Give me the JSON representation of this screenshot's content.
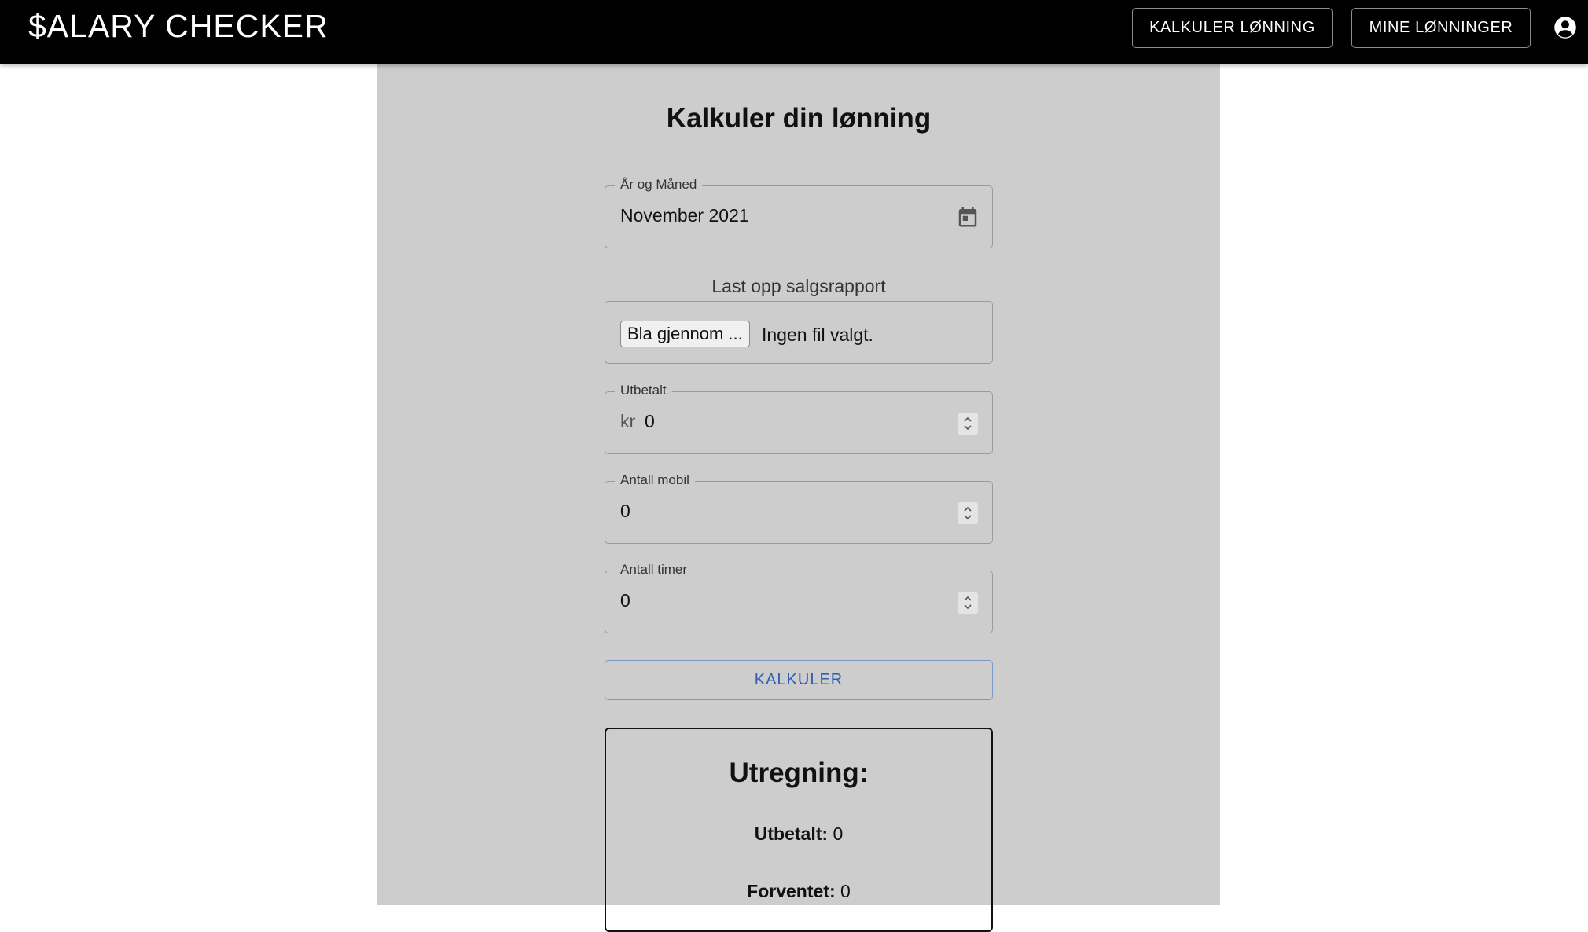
{
  "header": {
    "brand": "$ALARY CHECKER",
    "nav": [
      {
        "label": "KALKULER LØNNING"
      },
      {
        "label": "MINE LØNNINGER"
      }
    ],
    "account_icon": "account-circle-icon"
  },
  "form": {
    "title": "Kalkuler din lønning",
    "month_field": {
      "label": "År og Måned",
      "value": "November 2021",
      "icon": "calendar-icon"
    },
    "upload": {
      "label": "Last opp salgsrapport",
      "button": "Bla gjennom ...",
      "status": "Ingen fil valgt."
    },
    "paid_field": {
      "label": "Utbetalt",
      "prefix": "kr",
      "value": "0"
    },
    "mobile_field": {
      "label": "Antall mobil",
      "value": "0"
    },
    "hours_field": {
      "label": "Antall timer",
      "value": "0"
    },
    "submit_label": "KALKULER"
  },
  "result": {
    "title": "Utregning:",
    "paid_label": "Utbetalt:",
    "paid_value": "0",
    "expected_label": "Forventet:",
    "expected_value": "0"
  }
}
